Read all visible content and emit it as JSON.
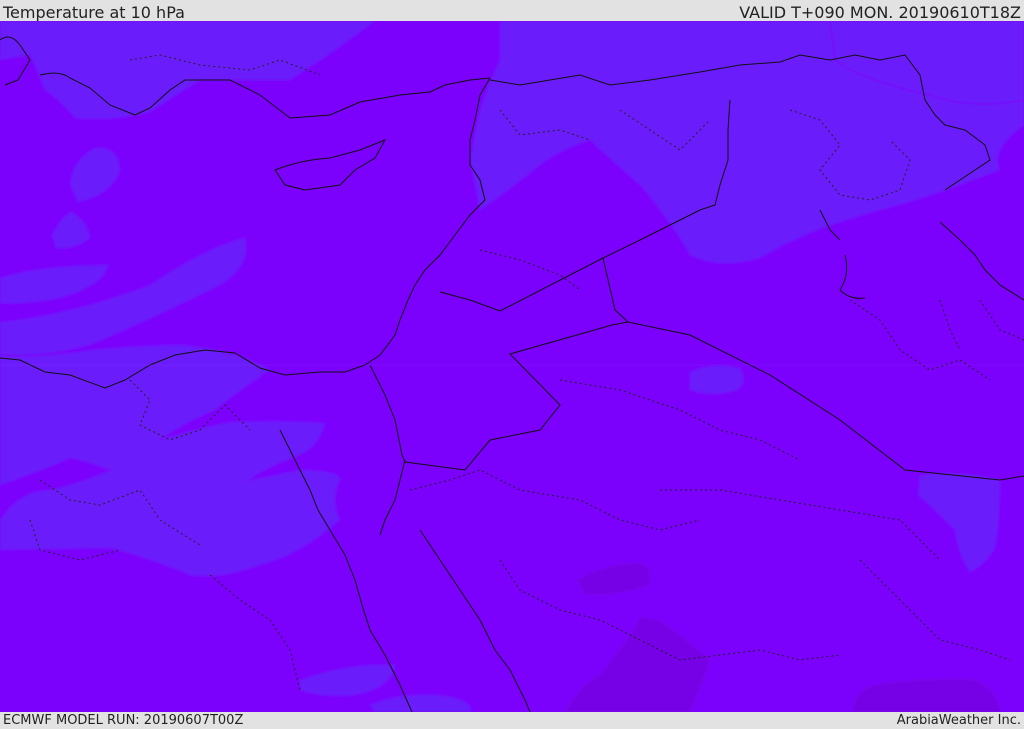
{
  "header": {
    "title": "Temperature at 10 hPa",
    "valid_time": "VALID T+090 MON. 20190610T18Z"
  },
  "footer": {
    "model_run": "ECMWF MODEL RUN: 20190607T00Z",
    "credit": "ArabiaWeather Inc."
  },
  "colors": {
    "field_main": "#7b00fc",
    "field_cooler": "#6b1cfb",
    "field_cool_edge": "#7410fc",
    "field_warmer": "#7600e6",
    "coast_line": "#111111",
    "admin_line": "#222222",
    "frame": "#e2e2e2"
  }
}
